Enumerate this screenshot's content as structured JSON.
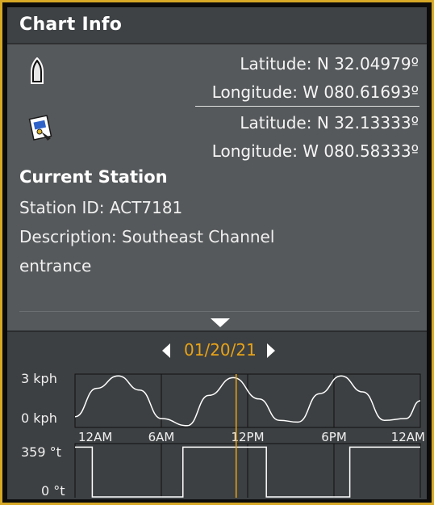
{
  "window": {
    "title": "Chart Info"
  },
  "boat_position": {
    "icon": "boat-icon",
    "latitude": "Latitude: N 32.04979º",
    "longitude": "Longitude: W 080.61693º"
  },
  "cursor_position": {
    "icon": "chart-cursor-icon",
    "latitude": "Latitude: N 32.13333º",
    "longitude": "Longitude: W 080.58333º"
  },
  "station": {
    "heading": "Current Station",
    "station_id": "Station ID: ACT7181",
    "description_line1": "Description: Southeast Channel",
    "description_line2": "entrance"
  },
  "expand": {
    "icon": "chevron-down-icon"
  },
  "graph": {
    "date": "01/20/21",
    "prev_icon": "triangle-left-icon",
    "next_icon": "triangle-right-icon",
    "speed_max_label": "3 kph",
    "speed_min_label": "0 kph",
    "dir_max_label": "359 °t",
    "dir_min_label": "0 °t",
    "time_labels": [
      "12AM",
      "6AM",
      "12PM",
      "6PM",
      "12AM"
    ],
    "colors": {
      "accent": "#e8a317",
      "frame": "#d6a826",
      "line": "#ffffff"
    }
  },
  "chart_data": {
    "type": "line",
    "x_unit": "hours",
    "xlim": [
      0,
      24
    ],
    "series": [
      {
        "values": [
          {
            "x": 0,
            "y": 0.6
          },
          {
            "x": 1.5,
            "y": 2.2
          },
          {
            "x": 3,
            "y": 2.9
          },
          {
            "x": 4.5,
            "y": 2.1
          },
          {
            "x": 6,
            "y": 0.5
          },
          {
            "x": 7.8,
            "y": 0.1
          },
          {
            "x": 9.3,
            "y": 1.8
          },
          {
            "x": 11,
            "y": 2.8
          },
          {
            "x": 12.8,
            "y": 1.6
          },
          {
            "x": 14.2,
            "y": 0.4
          },
          {
            "x": 15.5,
            "y": 0.3
          },
          {
            "x": 17,
            "y": 1.9
          },
          {
            "x": 18.5,
            "y": 2.9
          },
          {
            "x": 20,
            "y": 2.0
          },
          {
            "x": 21.5,
            "y": 0.4
          },
          {
            "x": 23,
            "y": 0.5
          },
          {
            "x": 24,
            "y": 1.5
          }
        ],
        "ylim": [
          0,
          3
        ]
      },
      {
        "values": [
          {
            "x": 0,
            "y": 359
          },
          {
            "x": 1.2,
            "y": 359
          },
          {
            "x": 1.2,
            "y": 0
          },
          {
            "x": 7.5,
            "y": 0
          },
          {
            "x": 7.5,
            "y": 359
          },
          {
            "x": 13.3,
            "y": 359
          },
          {
            "x": 13.3,
            "y": 0
          },
          {
            "x": 19.1,
            "y": 0
          },
          {
            "x": 19.1,
            "y": 359
          },
          {
            "x": 24,
            "y": 359
          }
        ],
        "ylim": [
          0,
          359
        ]
      }
    ],
    "current_time_marker": 11.2
  }
}
